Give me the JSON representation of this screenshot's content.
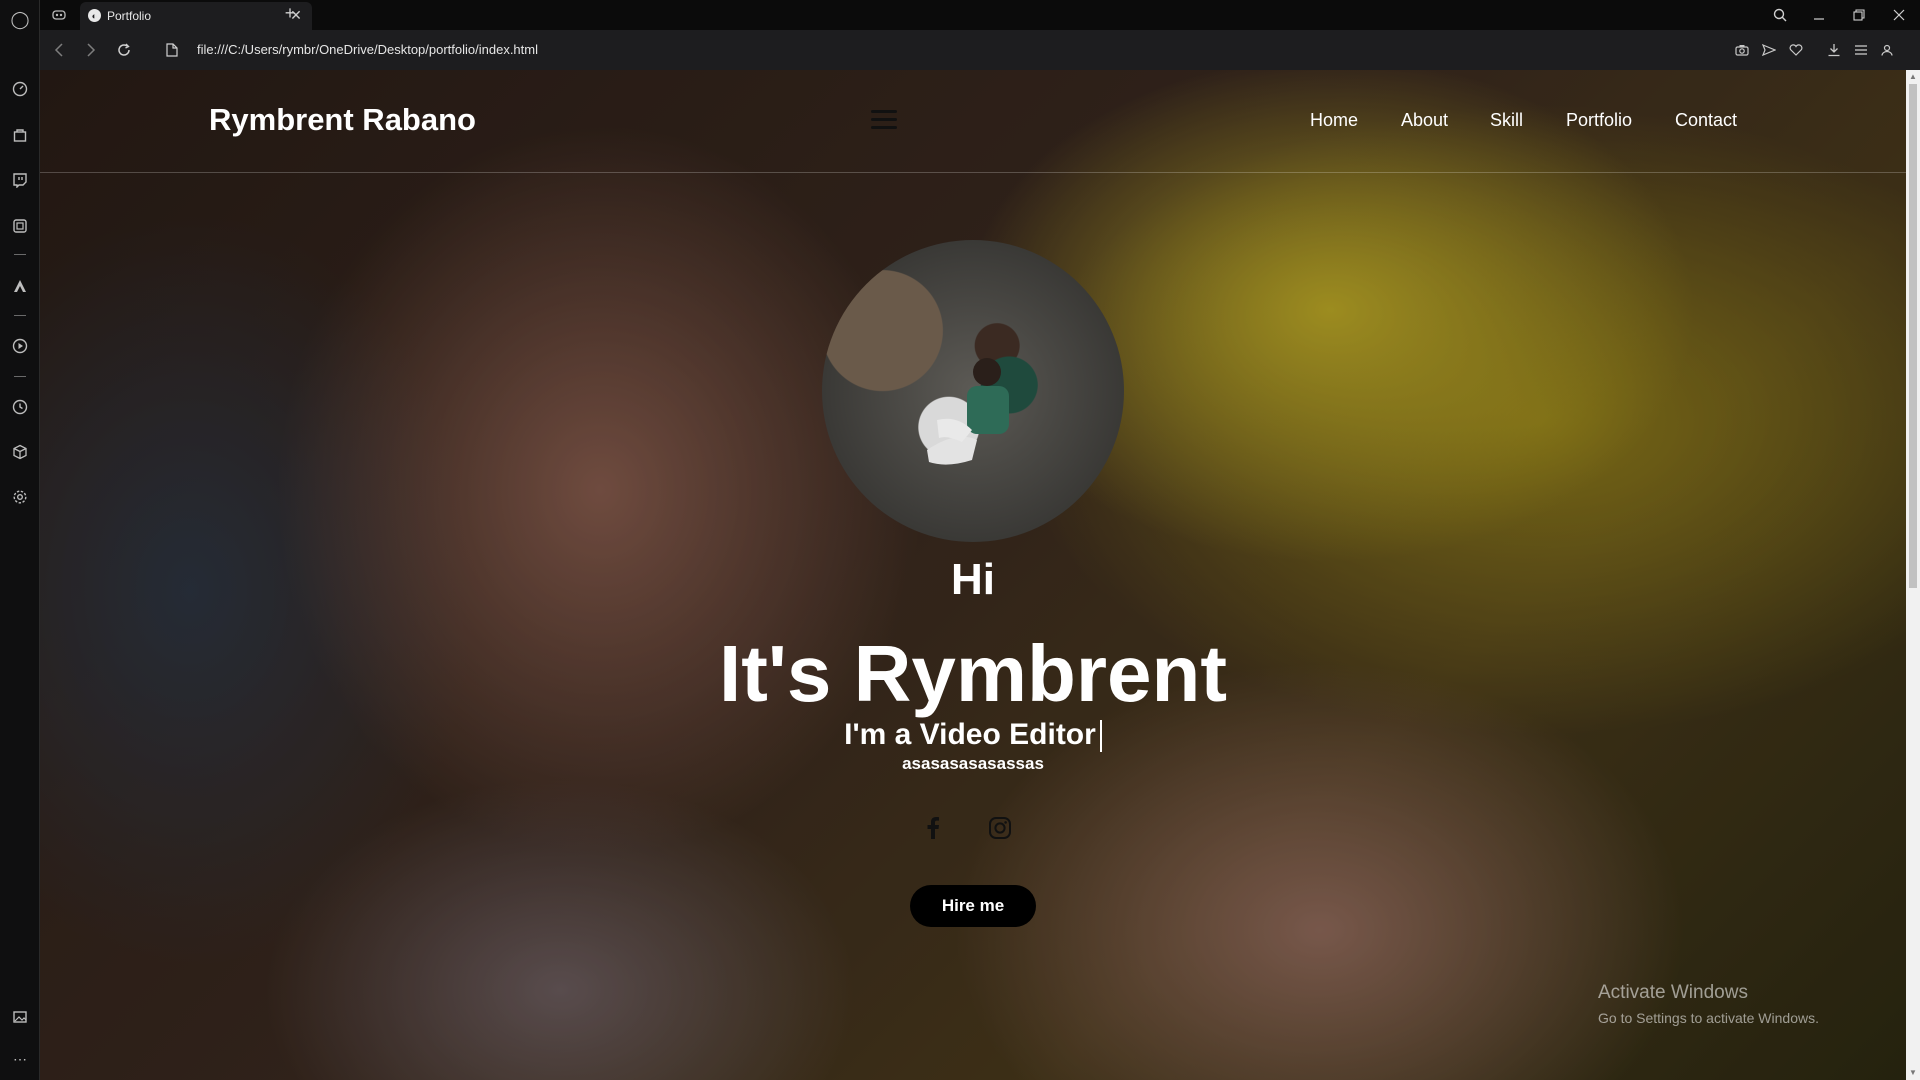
{
  "browser": {
    "tab_title": "Portfolio",
    "tab_close": "✕",
    "new_tab": "+",
    "url": "file:///C:/Users/rymbr/OneDrive/Desktop/portfolio/index.html"
  },
  "site": {
    "brand": "Rymbrent Rabano",
    "nav": [
      "Home",
      "About",
      "Skill",
      "Portfolio",
      "Contact"
    ],
    "hero": {
      "greeting": "Hi",
      "name": "It's Rymbrent",
      "role": "I'm a Video Editor",
      "subtitle": "asasasasasassas",
      "cta": "Hire me"
    },
    "social": [
      "facebook-icon",
      "instagram-icon"
    ]
  },
  "watermark": {
    "line1": "Activate Windows",
    "line2": "Go to Settings to activate Windows."
  },
  "colors": {
    "accent_yellow": "#c4b028",
    "header_text": "#ffffff",
    "button_bg": "#000000"
  }
}
